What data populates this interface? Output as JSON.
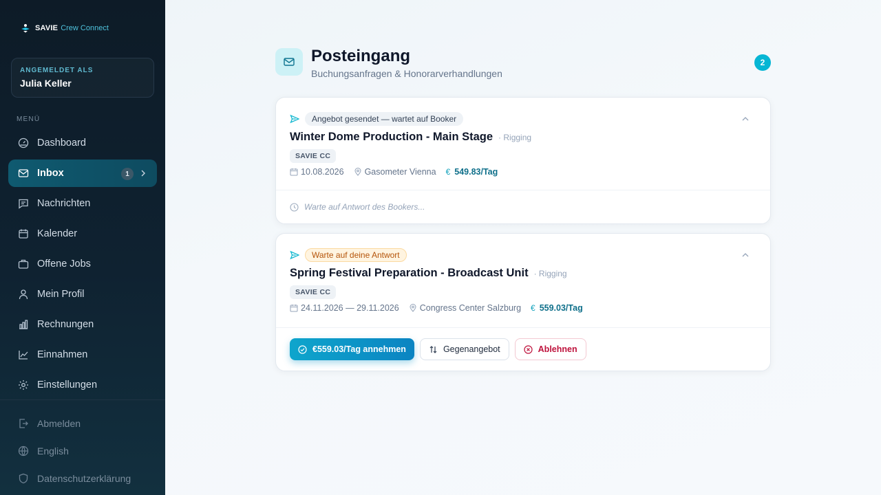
{
  "brand": {
    "name": "SAVIE",
    "sub": "Crew Connect"
  },
  "user": {
    "label": "ANGEMELDET ALS",
    "name": "Julia Keller"
  },
  "menu_label": "MENÜ",
  "nav": [
    {
      "label": "Dashboard",
      "icon": "gauge-icon"
    },
    {
      "label": "Inbox",
      "icon": "mail-icon",
      "badge": "1",
      "active": true
    },
    {
      "label": "Nachrichten",
      "icon": "chat-icon"
    },
    {
      "label": "Kalender",
      "icon": "calendar-icon"
    },
    {
      "label": "Offene Jobs",
      "icon": "briefcase-icon"
    },
    {
      "label": "Mein Profil",
      "icon": "user-icon"
    },
    {
      "label": "Rechnungen",
      "icon": "bar-chart-icon"
    },
    {
      "label": "Einnahmen",
      "icon": "line-chart-icon"
    },
    {
      "label": "Einstellungen",
      "icon": "gear-icon"
    }
  ],
  "footer_nav": [
    {
      "label": "Abmelden",
      "icon": "logout-icon"
    },
    {
      "label": "English",
      "icon": "globe-icon"
    },
    {
      "label": "Datenschutzerklärung",
      "icon": "shield-icon"
    }
  ],
  "page": {
    "title": "Posteingang",
    "subtitle": "Buchungsanfragen & Honorarverhandlungen",
    "count": "2"
  },
  "cards": [
    {
      "status": "Angebot gesendet — wartet auf Booker",
      "title": "Winter Dome Production - Main Stage",
      "category": "· Rigging",
      "org": "SAVIE CC",
      "date": "10.08.2026",
      "location": "Gasometer Vienna",
      "rate": "549.83/Tag",
      "waiting": "Warte auf Antwort des Bookers..."
    },
    {
      "status": "Warte auf deine Antwort",
      "title": "Spring Festival Preparation - Broadcast Unit",
      "category": "· Rigging",
      "org": "SAVIE CC",
      "date": "24.11.2026 — 29.11.2026",
      "location": "Congress Center Salzburg",
      "rate": "559.03/Tag",
      "actions": {
        "accept": "€559.03/Tag annehmen",
        "counter": "Gegenangebot",
        "decline": "Ablehnen"
      }
    }
  ],
  "colors": {
    "accent": "#06b6d4",
    "sidebar": "#0d1b27",
    "decline": "#be123c",
    "pending": "#b45309"
  }
}
